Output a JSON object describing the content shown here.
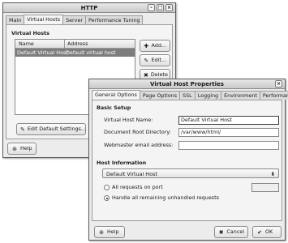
{
  "http_window": {
    "title": "HTTP",
    "tabs": [
      "Main",
      "Virtual Hosts",
      "Server",
      "Performance Tuning"
    ],
    "section_title": "Virtual Hosts",
    "columns": [
      "Name",
      "Address"
    ],
    "rows": [
      {
        "name": "Default Virtual Host",
        "address": "Default virtual host"
      }
    ],
    "buttons": {
      "add": "Add...",
      "edit": "Edit...",
      "delete": "Delete",
      "edit_default": "Edit Default Settings...",
      "help": "Help"
    }
  },
  "vhost_dialog": {
    "title": "Virtual Host Properties",
    "tabs": [
      "General Options",
      "Page Options",
      "SSL",
      "Logging",
      "Environment",
      "Performance"
    ],
    "basic_setup": {
      "heading": "Basic Setup",
      "name_label": "Virtual Host Name:",
      "name_value": "Default Virtual Host",
      "docroot_label": "Document Root Directory:",
      "docroot_value": "/var/www/html/",
      "email_label": "Webmaster email address:",
      "email_value": ""
    },
    "host_information": {
      "heading": "Host Information",
      "select_value": "Default Virtual Host",
      "radio_all_label": "All requests on port",
      "radio_unhandled_label": "Handle all remaining unhandled requests"
    },
    "buttons": {
      "help": "Help",
      "cancel": "Cancel",
      "ok": "OK"
    }
  }
}
